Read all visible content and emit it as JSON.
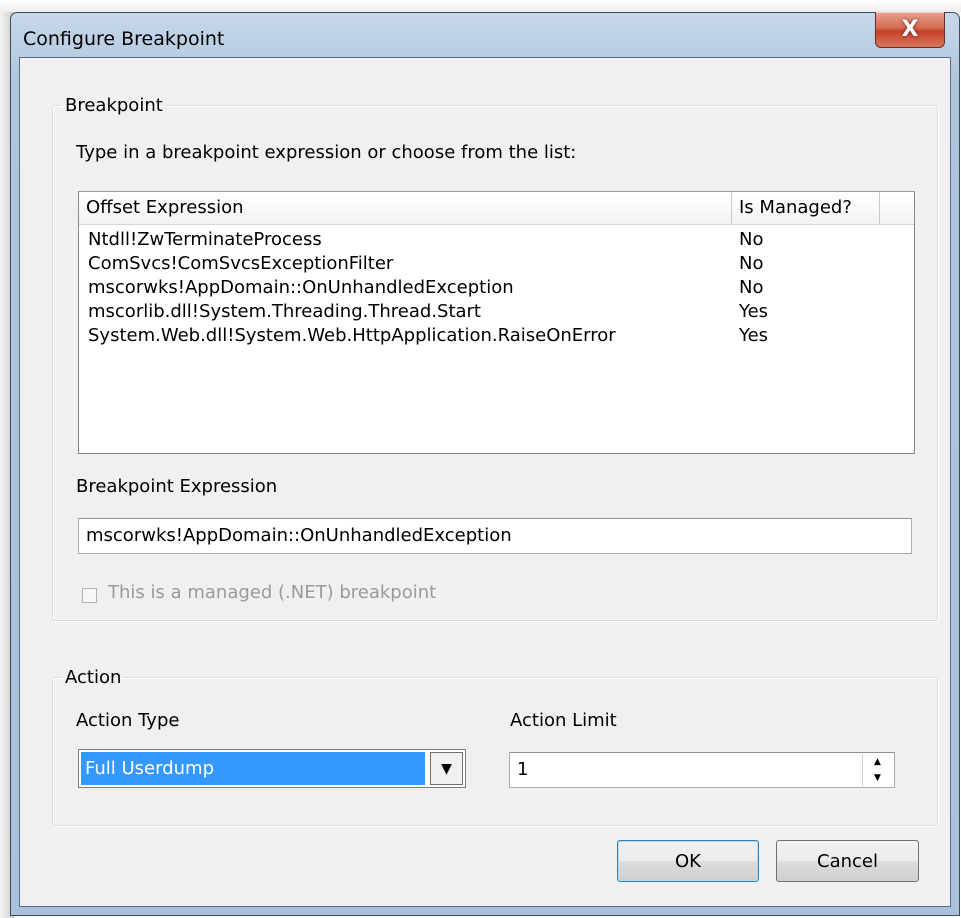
{
  "window": {
    "title": "Configure Breakpoint",
    "close_glyph": "X"
  },
  "breakpoint_group": {
    "legend": "Breakpoint",
    "instruction": "Type in a breakpoint expression or choose from the list:",
    "list": {
      "columns": [
        "Offset Expression",
        "Is Managed?"
      ],
      "rows": [
        {
          "expression": "Ntdll!ZwTerminateProcess",
          "managed": "No"
        },
        {
          "expression": "ComSvcs!ComSvcsExceptionFilter",
          "managed": "No"
        },
        {
          "expression": "mscorwks!AppDomain::OnUnhandledException",
          "managed": "No"
        },
        {
          "expression": "mscorlib.dll!System.Threading.Thread.Start",
          "managed": "Yes"
        },
        {
          "expression": "System.Web.dll!System.Web.HttpApplication.RaiseOnError",
          "managed": "Yes"
        }
      ]
    },
    "expression_label": "Breakpoint Expression",
    "expression_value": "mscorwks!AppDomain::OnUnhandledException",
    "managed_checkbox_label": "This is a managed (.NET) breakpoint"
  },
  "action_group": {
    "legend": "Action",
    "action_type_label": "Action Type",
    "action_type_value": "Full Userdump",
    "action_limit_label": "Action Limit",
    "action_limit_value": "1"
  },
  "buttons": {
    "ok": "OK",
    "cancel": "Cancel"
  },
  "colors": {
    "selection": "#3399ff",
    "close_button": "#c5412a",
    "title_bar": "#b9cde3"
  }
}
